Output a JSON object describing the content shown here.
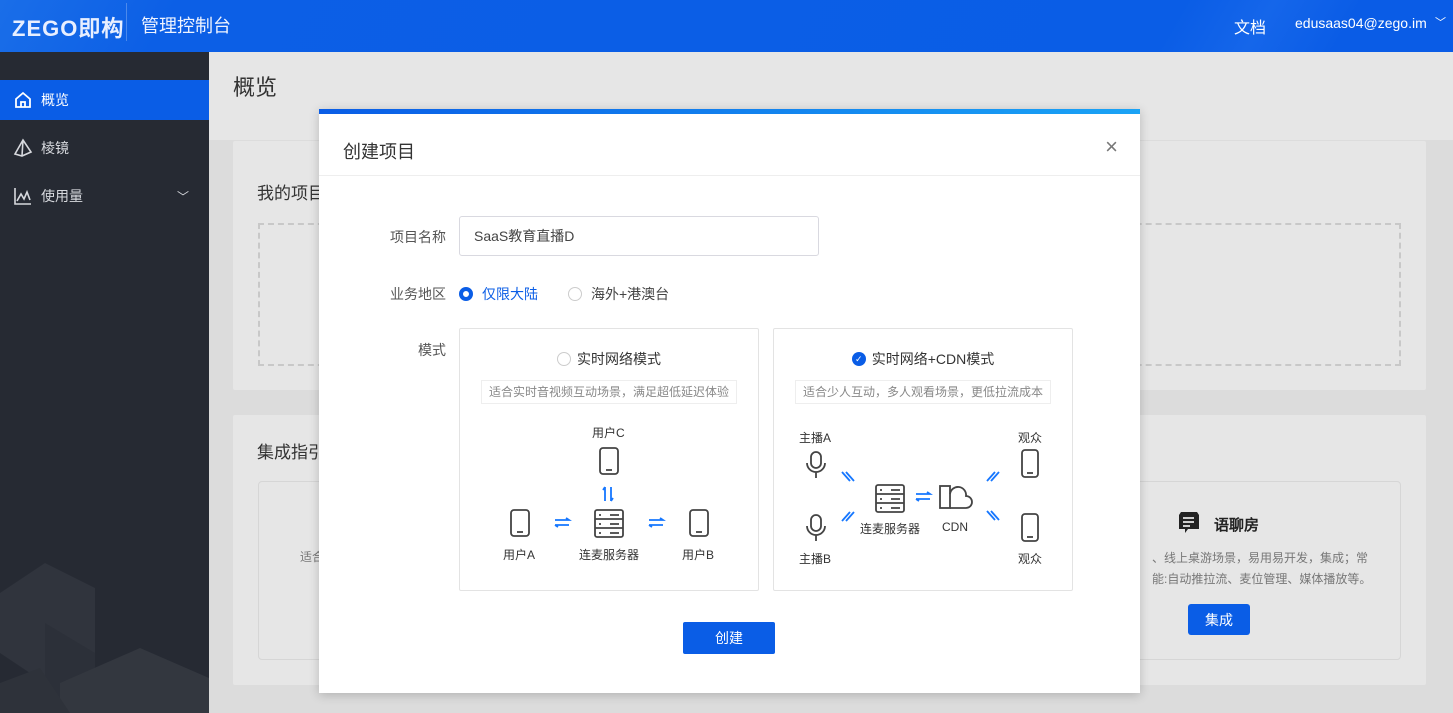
{
  "header": {
    "logo": "ZEGO即构",
    "title": "管理控制台",
    "docs": "文档",
    "user": "edusaas04@zego.im",
    "colors": {
      "brand": "#0a5de6"
    }
  },
  "sidebar": {
    "items": [
      {
        "label": "概览",
        "icon": "home-icon",
        "active": true
      },
      {
        "label": "棱镜",
        "icon": "prism-icon"
      },
      {
        "label": "使用量",
        "icon": "chart-icon",
        "expandable": true
      }
    ]
  },
  "main": {
    "title": "概览",
    "my_projects_title": "我的项目",
    "integration_title": "集成指引",
    "left_fragment": "适合",
    "voice_room": {
      "title": "语聊房",
      "desc_line1": "、线上桌游场景，易用易开发，集成；常",
      "desc_line2": "能:自动推拉流、麦位管理、媒体播放等。",
      "button": "集成"
    }
  },
  "modal": {
    "title": "创建项目",
    "form": {
      "name_label": "项目名称",
      "name_value": "SaaS教育直播D",
      "region_label": "业务地区",
      "regions": [
        {
          "label": "仅限大陆",
          "selected": true
        },
        {
          "label": "海外+港澳台",
          "selected": false
        }
      ],
      "mode_label": "模式",
      "modes": [
        {
          "label": "实时网络模式",
          "selected": false,
          "desc": "适合实时音视频互动场景，满足超低延迟体验",
          "diagram": {
            "top": "用户C",
            "left": "用户A",
            "center": "连麦服务器",
            "right": "用户B"
          }
        },
        {
          "label": "实时网络+CDN模式",
          "selected": true,
          "desc": "适合少人互动，多人观看场景，更低拉流成本",
          "diagram": {
            "host_a": "主播A",
            "host_b": "主播B",
            "server": "连麦服务器",
            "cdn": "CDN",
            "viewer_top": "观众",
            "viewer_bottom": "观众"
          }
        }
      ]
    },
    "submit": "创建"
  }
}
